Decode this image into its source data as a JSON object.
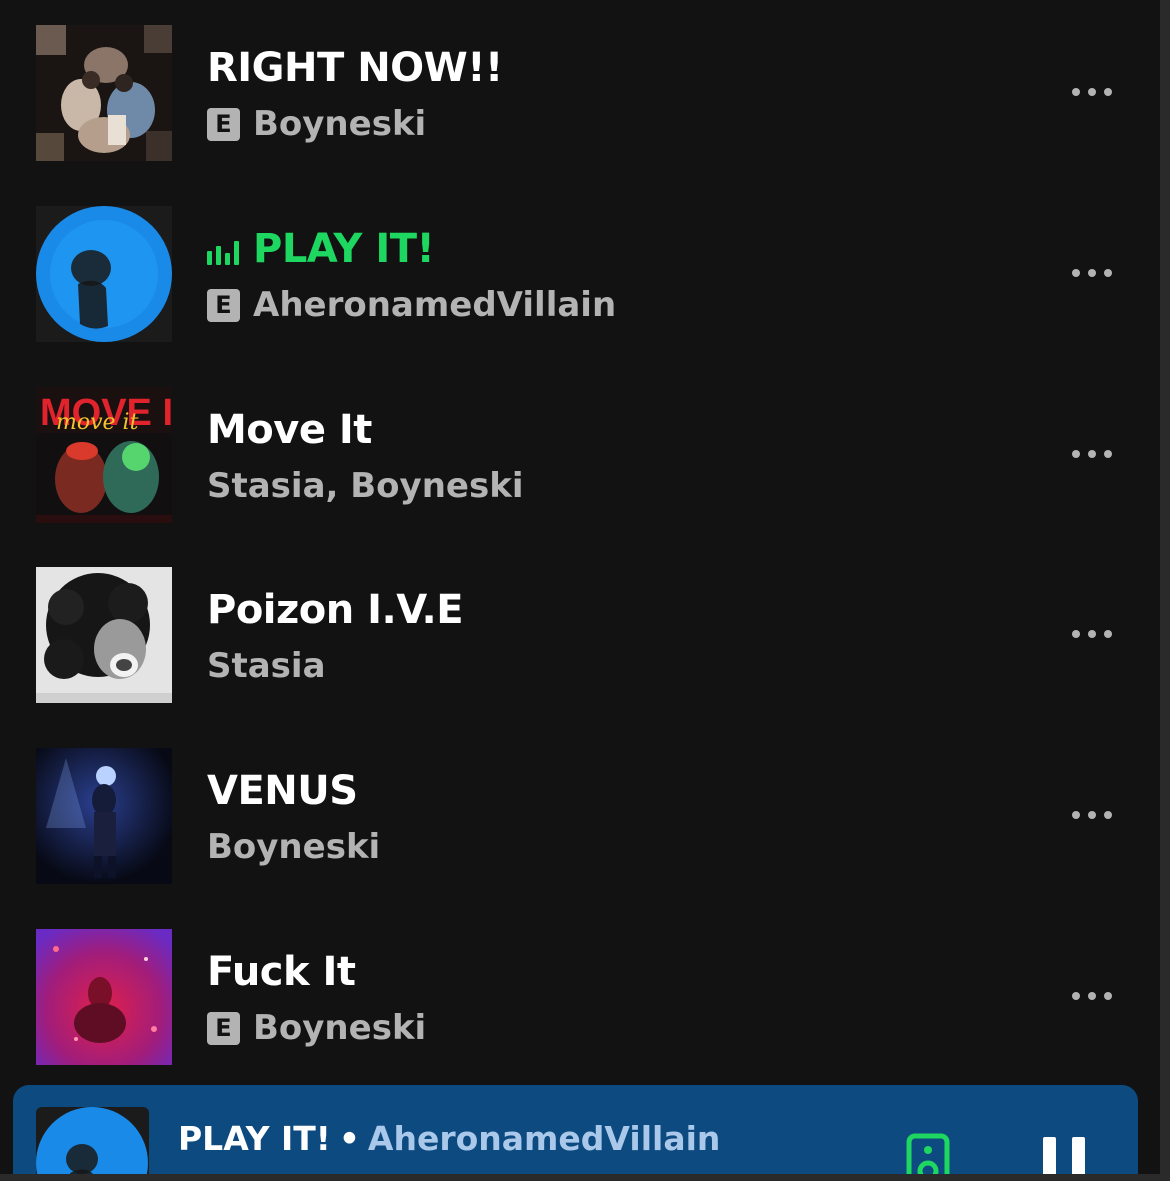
{
  "tracks": [
    {
      "title": "RIGHT NOW!!",
      "artist": "Boyneski",
      "explicit": true,
      "playing": false,
      "cover_icon": "party-collage-cover"
    },
    {
      "title": "PLAY IT!",
      "artist": "AheronamedVillain",
      "explicit": true,
      "playing": true,
      "cover_icon": "blue-circle-silhouette-cover"
    },
    {
      "title": "Move It",
      "artist": "Stasia, Boyneski",
      "explicit": false,
      "playing": false,
      "cover_icon": "move-it-cover",
      "cover_text": "MOVE IT",
      "cover_subtext": "move it"
    },
    {
      "title": "Poizon I.V.E",
      "artist": "Stasia",
      "explicit": false,
      "playing": false,
      "cover_icon": "curly-hair-portrait-cover"
    },
    {
      "title": "VENUS",
      "artist": "Boyneski",
      "explicit": false,
      "playing": false,
      "cover_icon": "spotlight-figure-cover"
    },
    {
      "title": "Fuck It",
      "artist": "Boyneski",
      "explicit": true,
      "playing": false,
      "cover_icon": "red-purple-glow-cover"
    }
  ],
  "explicit_label": "E",
  "mini_player": {
    "title": "PLAY IT!",
    "separator": "•",
    "artist": "AheronamedVillain",
    "device_icon": "speaker-device-icon",
    "control_icon": "pause-icon"
  },
  "colors": {
    "background": "#121212",
    "accent_green": "#1ed760",
    "mini_player_bg": "#0d4a80",
    "secondary_text": "#b3b3b3"
  }
}
